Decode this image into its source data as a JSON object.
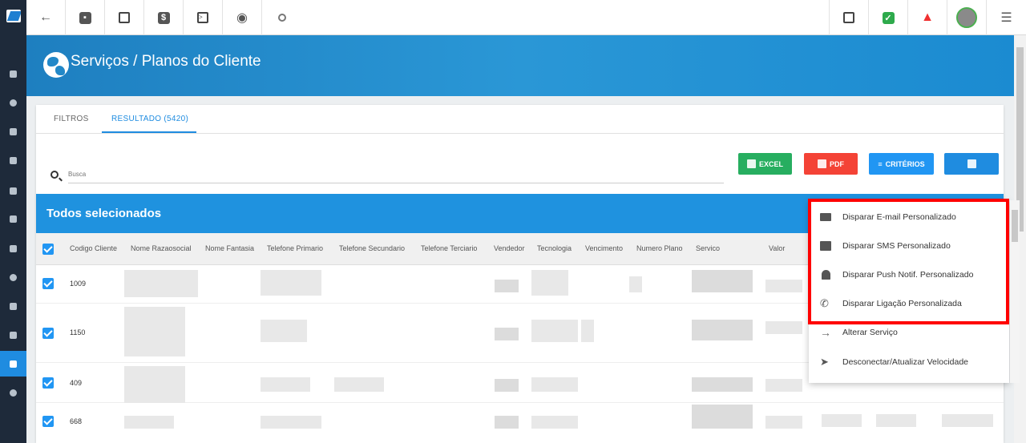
{
  "toolbar": {
    "left_icons": [
      "back-arrow-icon",
      "contact-card-icon",
      "calendar-clock-icon",
      "dollar-icon",
      "terminal-icon",
      "eye-icon",
      "search-icon"
    ],
    "right_icons": [
      "pdf-icon",
      "check-icon",
      "alarm-bell-icon",
      "avatar",
      "list-icon"
    ]
  },
  "banner": {
    "title": "Serviços / Planos do Cliente"
  },
  "tabs": [
    {
      "label": "FILTROS"
    },
    {
      "label": "RESULTADO (5420)"
    }
  ],
  "search": {
    "placeholder": "Busca"
  },
  "buttons": {
    "excel": "EXCEL",
    "pdf": "PDF",
    "criterios": "CRITÉRIOS"
  },
  "colors": {
    "excel": "#27ae60",
    "pdf": "#f44336",
    "criterios": "#2196f3",
    "settings": "#1f8ce0",
    "header": "#1f92df"
  },
  "table": {
    "selection_label": "Todos selecionados",
    "columns": [
      "Codigo Cliente",
      "Nome Razaosocial",
      "Nome Fantasia",
      "Telefone Primario",
      "Telefone Secundario",
      "Telefone Terciario",
      "Vendedor",
      "Tecnologia",
      "Vencimento",
      "Numero Plano",
      "Servico",
      "Valor"
    ],
    "rows": [
      {
        "codigo": "1009"
      },
      {
        "codigo": "1150"
      },
      {
        "codigo": "409"
      },
      {
        "codigo": "668"
      }
    ]
  },
  "menu": {
    "items": [
      {
        "label": "Disparar E-mail Personalizado",
        "icon": "email-icon"
      },
      {
        "label": "Disparar SMS Personalizado",
        "icon": "sms-icon"
      },
      {
        "label": "Disparar Push Notif. Personalizado",
        "icon": "bell-icon"
      },
      {
        "label": "Disparar Ligação Personalizada",
        "icon": "phone-icon"
      },
      {
        "label": "Alterar Serviço",
        "icon": "arrow-right-icon"
      },
      {
        "label": "Desconectar/Atualizar Velocidade",
        "icon": "send-icon"
      }
    ]
  }
}
